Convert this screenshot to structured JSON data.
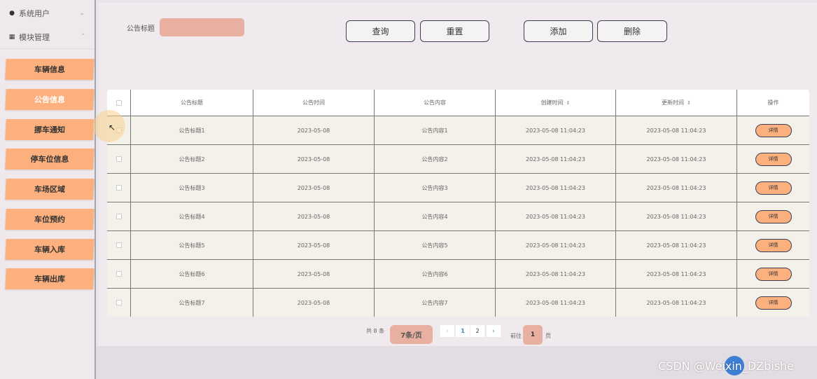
{
  "sidebar": {
    "system_users": "系统用户",
    "module_mgmt": "模块管理",
    "items": [
      {
        "label": "车辆信息"
      },
      {
        "label": "公告信息"
      },
      {
        "label": "挪车通知"
      },
      {
        "label": "停车位信息"
      },
      {
        "label": "车场区域"
      },
      {
        "label": "车位预约"
      },
      {
        "label": "车辆入库"
      },
      {
        "label": "车辆出库"
      }
    ],
    "active_index": 1
  },
  "search": {
    "label": "公告标题",
    "value": ""
  },
  "toolbar": {
    "query": "查询",
    "reset": "重置",
    "add": "添加",
    "delete": "删除"
  },
  "table": {
    "headers": {
      "title": "公告标题",
      "date": "公告时间",
      "content": "公告内容",
      "created": "创建时间",
      "updated": "更新时间",
      "action": "操作"
    },
    "rows": [
      {
        "title": "公告标题1",
        "date": "2023-05-08",
        "content": "公告内容1",
        "created": "2023-05-08 11:04:23",
        "updated": "2023-05-08 11:04:23",
        "action": "详情"
      },
      {
        "title": "公告标题2",
        "date": "2023-05-08",
        "content": "公告内容2",
        "created": "2023-05-08 11:04:23",
        "updated": "2023-05-08 11:04:23",
        "action": "详情"
      },
      {
        "title": "公告标题3",
        "date": "2023-05-08",
        "content": "公告内容3",
        "created": "2023-05-08 11:04:23",
        "updated": "2023-05-08 11:04:23",
        "action": "详情"
      },
      {
        "title": "公告标题4",
        "date": "2023-05-08",
        "content": "公告内容4",
        "created": "2023-05-08 11:04:23",
        "updated": "2023-05-08 11:04:23",
        "action": "详情"
      },
      {
        "title": "公告标题5",
        "date": "2023-05-08",
        "content": "公告内容5",
        "created": "2023-05-08 11:04:23",
        "updated": "2023-05-08 11:04:23",
        "action": "详情"
      },
      {
        "title": "公告标题6",
        "date": "2023-05-08",
        "content": "公告内容6",
        "created": "2023-05-08 11:04:23",
        "updated": "2023-05-08 11:04:23",
        "action": "详情"
      },
      {
        "title": "公告标题7",
        "date": "2023-05-08",
        "content": "公告内容7",
        "created": "2023-05-08 11:04:23",
        "updated": "2023-05-08 11:04:23",
        "action": "详情"
      }
    ]
  },
  "pagination": {
    "total": "共 8 条",
    "page_size": "7条/页",
    "prev": "‹",
    "pages": [
      "1",
      "2"
    ],
    "next": "›",
    "goto": "前往",
    "jump_value": "1",
    "page_suffix": "页"
  },
  "watermark": "CSDN @Weixin_DZbishe",
  "colors": {
    "accent": "#fbb07e",
    "input_fill": "#e8b0a0",
    "border_dark": "#3b3f55",
    "page_active": "#3b82c4"
  }
}
